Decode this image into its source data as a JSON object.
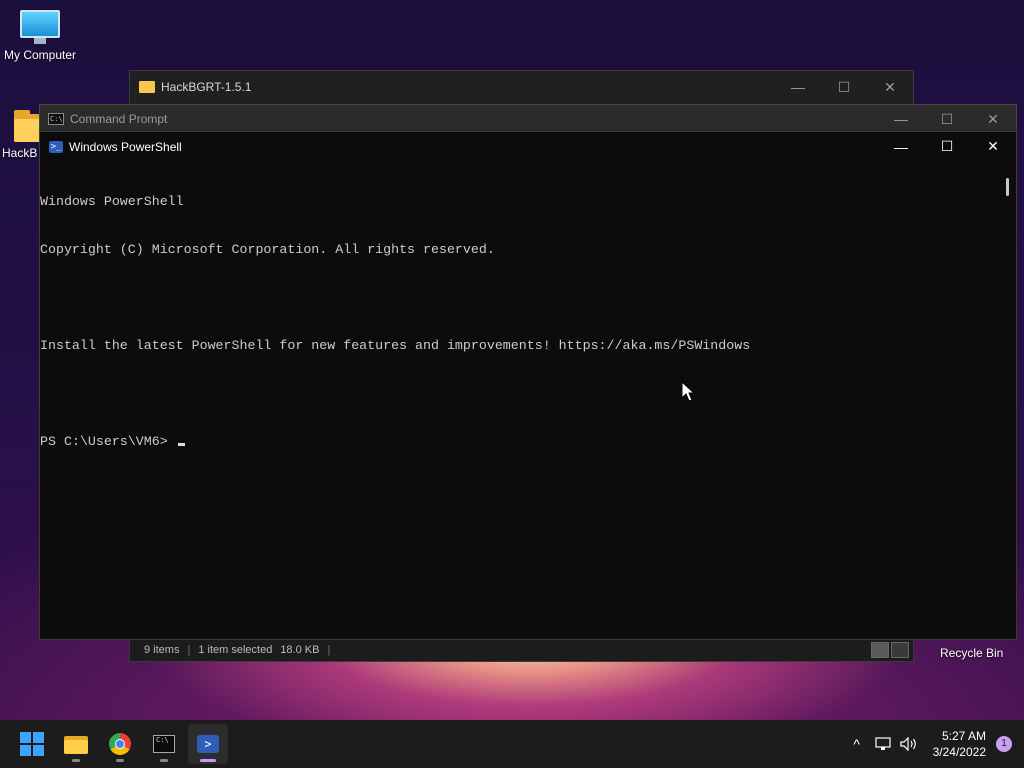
{
  "desktop": {
    "icons": [
      {
        "label": "My Computer"
      },
      {
        "label": "HackB"
      }
    ],
    "recycle_bin_label": "Recycle Bin"
  },
  "explorer": {
    "title": "HackBGRT-1.5.1",
    "status": {
      "items": "9 items",
      "selected": "1 item selected",
      "size": "18.0 KB"
    }
  },
  "cmd": {
    "title": "Command Prompt"
  },
  "powershell": {
    "title": "Windows PowerShell",
    "lines": [
      "Windows PowerShell",
      "Copyright (C) Microsoft Corporation. All rights reserved.",
      "",
      "Install the latest PowerShell for new features and improvements! https://aka.ms/PSWindows",
      ""
    ],
    "prompt": "PS C:\\Users\\VM6> "
  },
  "window_buttons": {
    "minimize": "—",
    "maximize": "☐",
    "close": "✕"
  },
  "taskbar": {
    "items": [
      {
        "icon": "start-icon"
      },
      {
        "icon": "file-explorer-icon"
      },
      {
        "icon": "chrome-icon"
      },
      {
        "icon": "command-prompt-icon"
      },
      {
        "icon": "powershell-icon",
        "active": true
      }
    ],
    "tray": {
      "chevron": "^",
      "time": "5:27 AM",
      "date": "3/24/2022",
      "notification_count": "1"
    }
  },
  "colors": {
    "ps_background": "#0c0c0c",
    "ps_text": "#cccccc",
    "accent": "#c79bff"
  }
}
